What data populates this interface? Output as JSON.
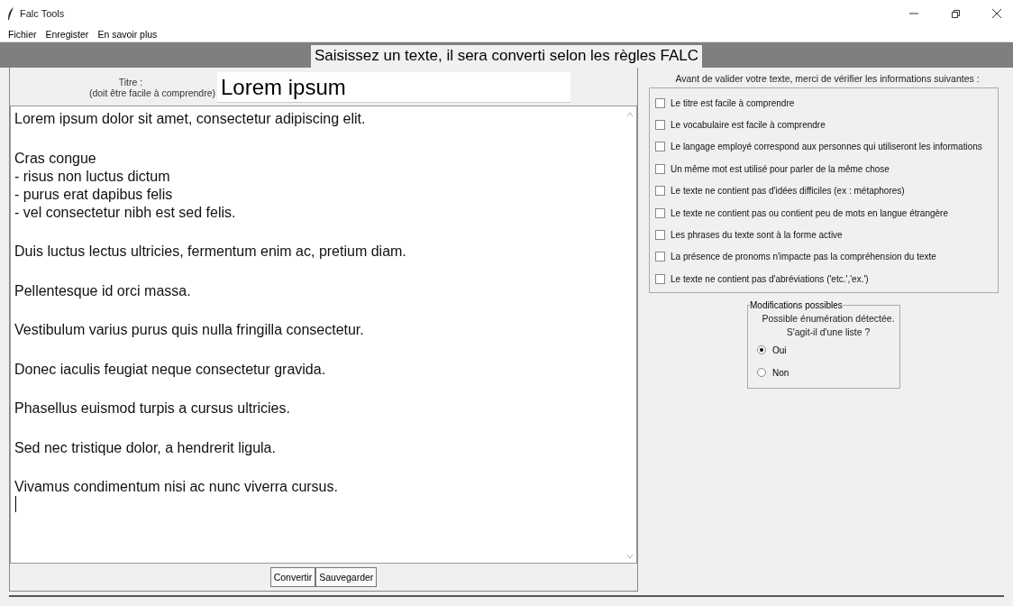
{
  "window": {
    "title": "Falc Tools"
  },
  "menu": [
    "Fichier",
    "Enregister",
    "En savoir plus"
  ],
  "header": "Saisissez un texte, il sera converti selon les règles FALC",
  "title_field": {
    "label_line_1": "Titre :",
    "label_line_2": "(doit être facile à comprendre)",
    "value": "Lorem ipsum"
  },
  "editor": {
    "paragraphs": [
      [
        "Lorem ipsum dolor sit amet, consectetur adipiscing elit."
      ],
      [
        "Cras congue",
        "- risus non luctus dictum",
        "- purus erat dapibus felis",
        "- vel consectetur nibh est sed felis."
      ],
      [
        "Duis luctus lectus ultricies, fermentum enim ac, pretium diam."
      ],
      [
        "Pellentesque id orci massa."
      ],
      [
        "Vestibulum varius purus quis nulla fringilla consectetur."
      ],
      [
        "Donec iaculis feugiat neque consectetur gravida."
      ],
      [
        "Phasellus euismod turpis a cursus ultricies."
      ],
      [
        "Sed nec tristique dolor, a hendrerit ligula."
      ],
      [
        "Vivamus condimentum nisi ac nunc viverra cursus."
      ]
    ]
  },
  "buttons": [
    "Convertir",
    "Sauvegarder"
  ],
  "checklist": {
    "intro": "Avant de valider votre texte, merci de vérifier les informations suivantes :",
    "items": [
      {
        "label": "Le titre est facile à comprendre",
        "checked": false
      },
      {
        "label": "Le vocabulaire est facile à comprendre",
        "checked": false
      },
      {
        "label": "Le langage employé correspond aux personnes qui utiliseront les informations",
        "checked": false
      },
      {
        "label": "Un même mot est utilisé pour parler de la même chose",
        "checked": false
      },
      {
        "label": "Le texte ne contient pas d'idées difficiles (ex : métaphores)",
        "checked": false
      },
      {
        "label": "Le texte ne contient pas ou contient peu de mots en langue étrangère",
        "checked": false
      },
      {
        "label": "Les phrases du texte sont à la forme active",
        "checked": false
      },
      {
        "label": "La présence de pronoms n'impacte pas la compréhension du texte",
        "checked": false
      },
      {
        "label": "Le texte ne contient pas d'abréviations ('etc.','ex.')",
        "checked": false
      }
    ]
  },
  "modifications": {
    "legend": "Modifications possibles",
    "message_line_1": "Possible énumération détectée.",
    "message_line_2": "S'agit-il d'une liste ?",
    "options": [
      {
        "label": "Oui",
        "selected": true
      },
      {
        "label": "Non",
        "selected": false
      }
    ]
  }
}
